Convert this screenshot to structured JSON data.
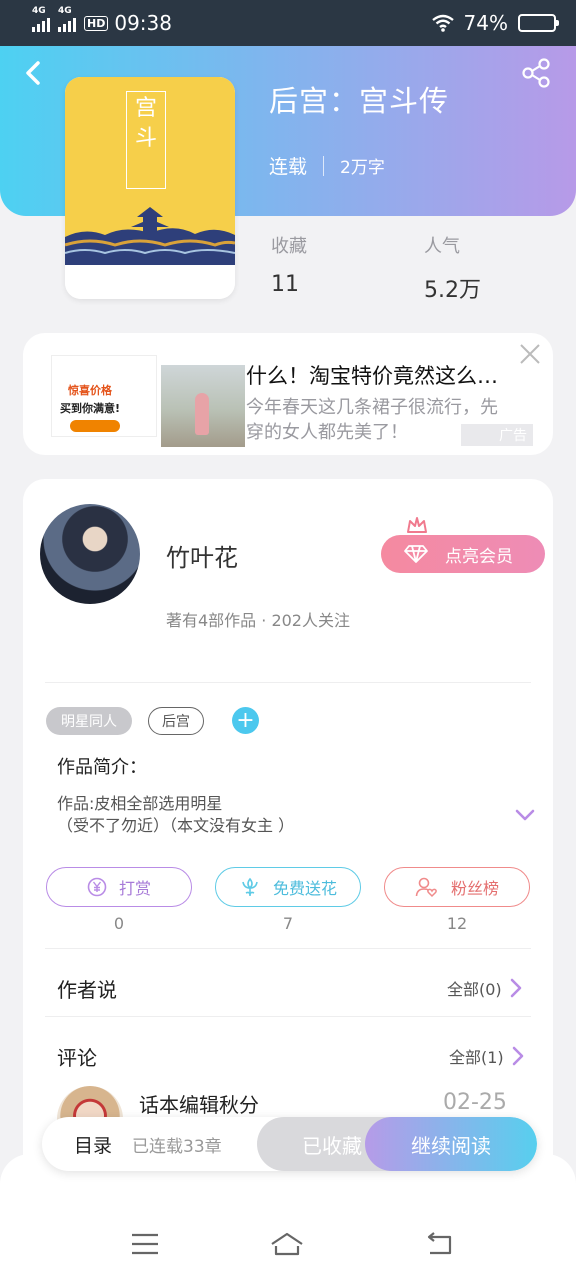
{
  "status_bar": {
    "network1": "4G",
    "network2": "4G",
    "hd": "HD",
    "time": "09:38",
    "battery_percent": "74%",
    "battery_level": 0.74
  },
  "book": {
    "title": "后宫：宫斗传",
    "status": "连载",
    "word_count": "2万字",
    "cover_chars": [
      "宫",
      "斗"
    ],
    "stats": [
      {
        "label": "收藏",
        "value": "11"
      },
      {
        "label": "人气",
        "value": "5.2万"
      }
    ]
  },
  "ad": {
    "title": "什么！淘宝特价竟然这么…",
    "description": "今年春天这几条裙子很流行，先穿的女人都先美了！",
    "tag": "广告",
    "img_text1": "惊喜价格",
    "img_text2": "买到你满意!"
  },
  "author": {
    "name": "竹叶花",
    "meta": "著有4部作品 · 202人关注",
    "vip_label": "点亮会员"
  },
  "tags": [
    "明星同人",
    "后宫"
  ],
  "intro": {
    "heading": "作品简介：",
    "body": "作品:皮相全部选用明星\n（受不了勿近）（本文没有女主 ）"
  },
  "actions": [
    {
      "label": "打赏",
      "count": "0"
    },
    {
      "label": "免费送花",
      "count": "7"
    },
    {
      "label": "粉丝榜",
      "count": "12"
    }
  ],
  "author_says": {
    "label": "作者说",
    "more": "全部(0)"
  },
  "comments": {
    "label": "评论",
    "more": "全部(1)",
    "first": {
      "name": "话本编辑秋分",
      "date": "02-25"
    }
  },
  "bottom_bar": {
    "toc": "目录",
    "chapter_count": "已连载33章",
    "favorite": "已收藏",
    "continue": "继续阅读"
  },
  "colors": {
    "header_start": "#4dd1f2",
    "header_end": "#b79ae8",
    "vip": "#f58aa0",
    "accent_blue": "#4cc8ee"
  }
}
